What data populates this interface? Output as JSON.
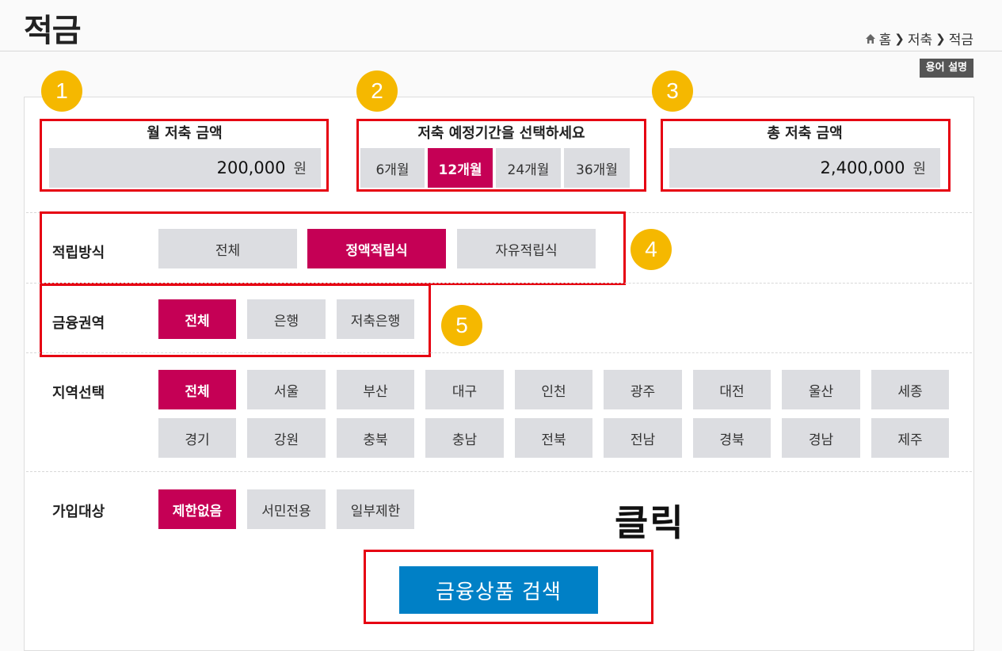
{
  "header": {
    "title": "적금",
    "breadcrumb": [
      "홈",
      "저축",
      "적금"
    ],
    "term_button": "용어 설명"
  },
  "badges": [
    "1",
    "2",
    "3",
    "4",
    "5"
  ],
  "monthly": {
    "title": "월 저축 금액",
    "amount": "200,000",
    "unit": "원"
  },
  "period": {
    "title": "저축 예정기간을 선택하세요",
    "options": [
      "6개월",
      "12개월",
      "24개월",
      "36개월"
    ],
    "selected": "12개월"
  },
  "total": {
    "title": "총 저축 금액",
    "amount": "2,400,000",
    "unit": "원"
  },
  "method": {
    "label": "적립방식",
    "options": [
      "전체",
      "정액적립식",
      "자유적립식"
    ],
    "selected": "정액적립식"
  },
  "sector": {
    "label": "금융권역",
    "options": [
      "전체",
      "은행",
      "저축은행"
    ],
    "selected": "전체"
  },
  "region": {
    "label": "지역선택",
    "options": [
      "전체",
      "서울",
      "부산",
      "대구",
      "인천",
      "광주",
      "대전",
      "울산",
      "세종",
      "경기",
      "강원",
      "충북",
      "충남",
      "전북",
      "전남",
      "경북",
      "경남",
      "제주"
    ],
    "selected": "전체"
  },
  "target": {
    "label": "가입대상",
    "options": [
      "제한없음",
      "서민전용",
      "일부제한"
    ],
    "selected": "제한없음"
  },
  "annotation": {
    "click": "클릭"
  },
  "search_button": "금융상품 검색",
  "colors": {
    "accent": "#c50055",
    "search": "#0080c6",
    "highlight": "#e60012",
    "badge": "#f5b800"
  }
}
